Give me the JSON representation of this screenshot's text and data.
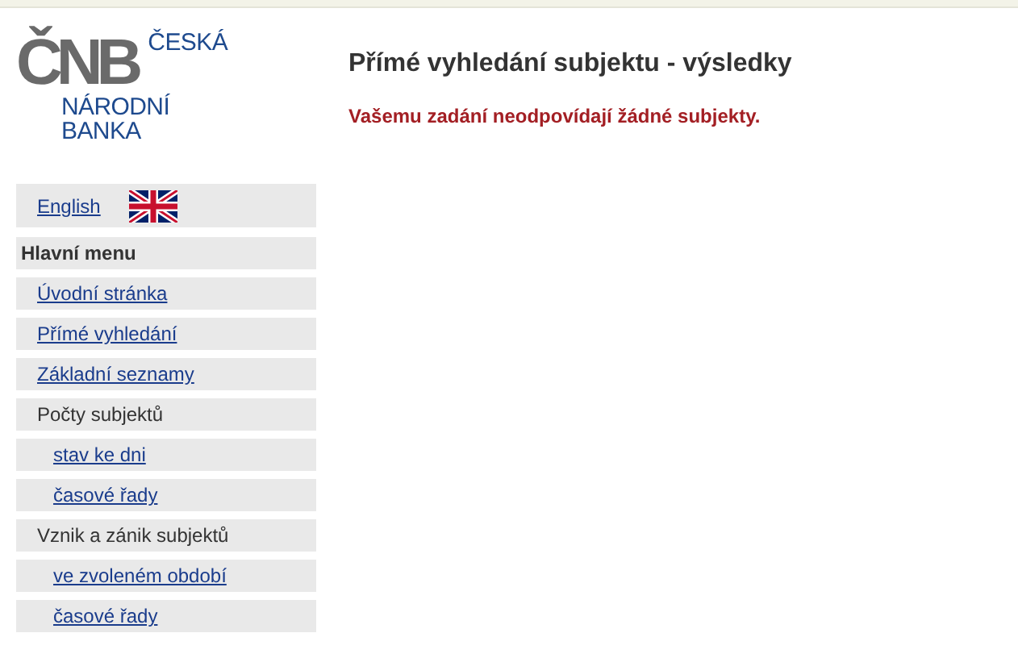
{
  "logo": {
    "mark": "ČNB",
    "lines": [
      "ČESKÁ",
      "NÁRODNÍ",
      "BANKA"
    ]
  },
  "language": {
    "label": "English"
  },
  "menu": {
    "title": "Hlavní menu",
    "items": [
      {
        "label": "Úvodní stránka",
        "link": true
      },
      {
        "label": "Přímé vyhledání",
        "link": true
      },
      {
        "label": "Základní seznamy",
        "link": true
      },
      {
        "label": "Počty subjektů",
        "link": false,
        "children": [
          {
            "label": "stav ke dni",
            "link": true
          },
          {
            "label": "časové řady",
            "link": true
          }
        ]
      },
      {
        "label": "Vznik a zánik subjektů",
        "link": false,
        "children": [
          {
            "label": "ve zvoleném období",
            "link": true
          },
          {
            "label": "časové řady",
            "link": true
          }
        ]
      }
    ]
  },
  "main": {
    "title": "Přímé vyhledání subjektu - výsledky",
    "message": "Vašemu zadání neodpovídají žádné subjekty."
  }
}
